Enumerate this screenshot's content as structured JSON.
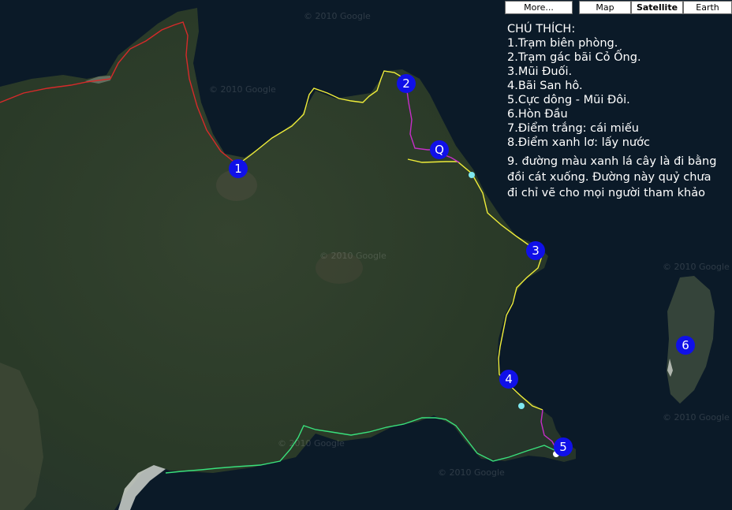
{
  "map_controls": {
    "more_label": "More...",
    "map_label": "Map",
    "satellite_label": "Satellite",
    "earth_label": "Earth",
    "active": "Satellite"
  },
  "legend": {
    "title": "CHÚ THÍCH:",
    "items": [
      "1.Trạm biên phòng.",
      "2.Trạm gác bãi Cỏ Ống.",
      "3.Mũi Đuối.",
      "4.Bãi San hô.",
      "5.Cực dông - Mũi Đôi.",
      "6.Hòn Đầu",
      "7.Điểm trắng: cái miếu",
      "8.Điểm xanh lơ: lấy nước"
    ],
    "note": "9. đường màu xanh lá cây là đi bằng đồi cát xuống. Đường này quỷ chưa đi chỉ vẽ cho mọi người tham khảo"
  },
  "markers": {
    "m1": "1",
    "m2": "2",
    "m3": "3",
    "m4": "4",
    "m5": "5",
    "m6": "6",
    "mq": "Q"
  },
  "watermark": "© 2010 Google",
  "colors": {
    "sea": "#0b1a28",
    "land": "#2b3a28",
    "marker": "#1010e8",
    "route_red": "#d62a2a",
    "route_yellow": "#f0ee3a",
    "route_magenta": "#c62ec8",
    "route_green": "#39e07c",
    "temple_white": "#ffffff",
    "water_cyan": "#7fe8f0"
  }
}
